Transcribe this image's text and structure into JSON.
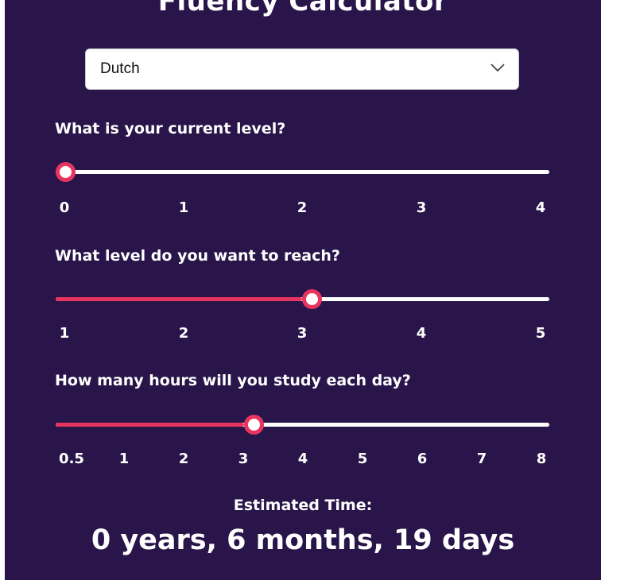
{
  "title": "Fluency Calculator",
  "language_select": {
    "selected": "Dutch"
  },
  "current_level": {
    "question": "What is your current level?",
    "ticks": [
      "0",
      "1",
      "2",
      "3",
      "4"
    ],
    "value": 0,
    "min": 0,
    "max": 4
  },
  "target_level": {
    "question": "What level do you want to reach?",
    "ticks": [
      "1",
      "2",
      "3",
      "4",
      "5"
    ],
    "value": 3,
    "min": 1,
    "max": 5
  },
  "study_hours": {
    "question": "How many hours will you study each day?",
    "ticks": [
      "0.5",
      "1",
      "2",
      "3",
      "4",
      "5",
      "6",
      "7",
      "8"
    ],
    "value": "3"
  },
  "estimate": {
    "label": "Estimated Time:",
    "value": "0 years, 6 months, 19 days"
  },
  "colors": {
    "panel_background": "#29154a",
    "accent": "#e8355f",
    "track": "#ffffff"
  }
}
